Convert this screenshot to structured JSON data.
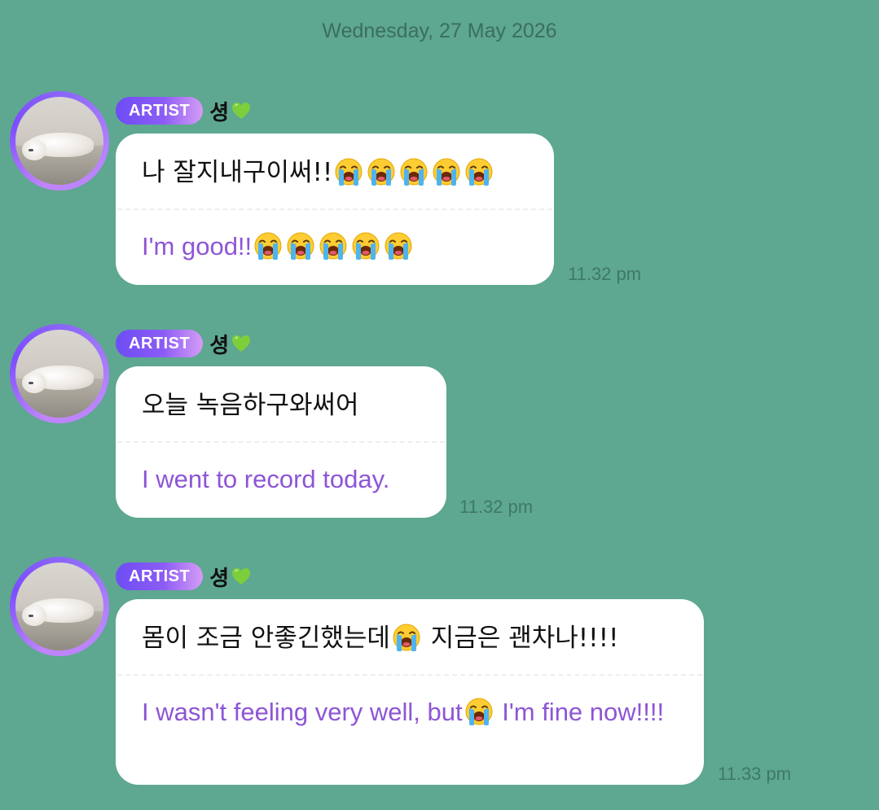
{
  "date_separator": "Wednesday, 27 May 2026",
  "colors": {
    "background": "#5ea791",
    "translation": "#8e55d6",
    "badge_start": "#6d4cf5",
    "badge_end": "#d59cf5"
  },
  "icons": {
    "heart": "green-heart-icon",
    "crying": "loudly-crying-face-icon"
  },
  "messages": [
    {
      "badge": "ARTIST",
      "name": "셩",
      "korean_parts": [
        "나 잘지내구이써!!"
      ],
      "korean_trailing_emojis": 5,
      "english_parts": [
        "I'm good!!"
      ],
      "english_trailing_emojis": 5,
      "time": "11.32 pm"
    },
    {
      "badge": "ARTIST",
      "name": "셩",
      "korean_parts": [
        "오늘 녹음하구와써어"
      ],
      "english_parts": [
        "I went to record today."
      ],
      "time": "11.32 pm"
    },
    {
      "badge": "ARTIST",
      "name": "셩",
      "korean_parts": [
        "몸이 조금 안좋긴했는데",
        " 지금은 괜차나!!!!"
      ],
      "english_parts": [
        "I wasn't feeling very well, but",
        " I'm fine now!!!!"
      ],
      "time": "11.33 pm"
    }
  ]
}
